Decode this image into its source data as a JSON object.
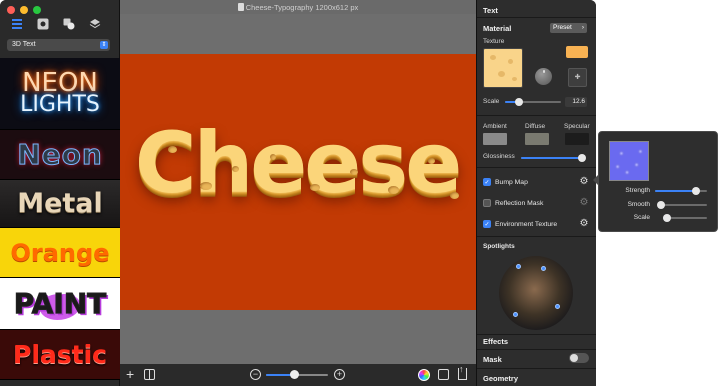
{
  "window": {
    "title": "Cheese-Typography 1200x612 px"
  },
  "sidebar": {
    "dropdown_value": "3D Text",
    "presets": [
      {
        "line1": "NEON",
        "line2": "LIGHTS"
      },
      {
        "label": "Neon"
      },
      {
        "label": "Metal"
      },
      {
        "label": "Orange"
      },
      {
        "label": "PAINT"
      },
      {
        "label": "Plastic"
      }
    ]
  },
  "canvas": {
    "text": "Cheese",
    "background_color": "#c23a04",
    "zoom_level": 0.45
  },
  "inspector": {
    "section_text": "Text",
    "material_label": "Material",
    "preset_button": "Preset",
    "texture_label": "Texture",
    "scale_label": "Scale",
    "scale_value": "12.6",
    "scale_level": 0.25,
    "ambient_label": "Ambient",
    "diffuse_label": "Diffuse",
    "specular_label": "Specular",
    "glossiness_label": "Glossiness",
    "glossiness_level": 0.95,
    "bump_map_label": "Bump Map",
    "reflection_mask_label": "Reflection Mask",
    "environment_texture_label": "Environment Texture",
    "spotlights_label": "Spotlights",
    "effects_label": "Effects",
    "mask_label": "Mask",
    "geometry_label": "Geometry",
    "colors": {
      "texture_tint": "#f8b253",
      "ambient": "#8a8a8a",
      "diffuse": "#7a7a70",
      "specular": "#1c1c1c"
    }
  },
  "popover": {
    "strength_label": "Strength",
    "smooth_label": "Smooth",
    "scale_label": "Scale",
    "strength_level": 0.78,
    "smooth_level": 0.05,
    "scale_level": 0.1
  }
}
